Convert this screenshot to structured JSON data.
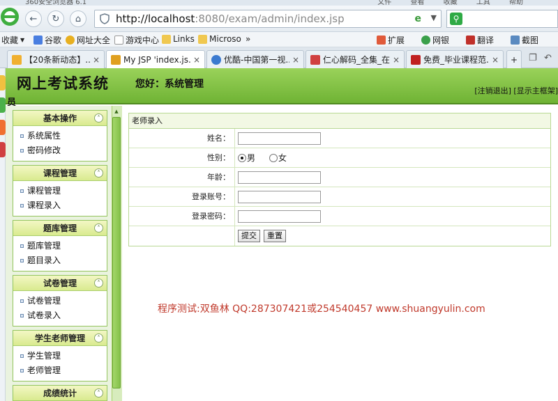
{
  "browser": {
    "title": "360安全浏览器 6.1",
    "menus": [
      "文件",
      "查看",
      "收藏",
      "工具",
      "帮助"
    ],
    "url_host": "http://localhost",
    "url_path": ":8080/exam/admin/index.jsp",
    "favorites_label": "收藏",
    "favorites": [
      "谷歌",
      "网址大全",
      "游戏中心",
      "Links",
      "Microso"
    ],
    "more": "»",
    "extensions": [
      "扩展",
      "网银",
      "翻译",
      "截图"
    ],
    "tabs": [
      {
        "label": "【20条新动态】..."
      },
      {
        "label": "My JSP 'index.js..."
      },
      {
        "label": "优酷-中国第一视..."
      },
      {
        "label": "仁心解码_全集_在..."
      },
      {
        "label": "免费_毕业课程范..."
      }
    ],
    "new_tab": "+"
  },
  "header": {
    "site_title": "网上考试系统",
    "greeting": "您好：系统管理",
    "greeting_overflow": "员",
    "logout": "[注销退出]",
    "show_frame": "[显示主框架]"
  },
  "sidebar": {
    "groups": [
      {
        "title": "基本操作",
        "items": [
          "系统属性",
          "密码修改"
        ]
      },
      {
        "title": "课程管理",
        "items": [
          "课程管理",
          "课程录入"
        ]
      },
      {
        "title": "题库管理",
        "items": [
          "题库管理",
          "题目录入"
        ]
      },
      {
        "title": "试卷管理",
        "items": [
          "试卷管理",
          "试卷录入"
        ]
      },
      {
        "title": "学生老师管理",
        "items": [
          "学生管理",
          "老师管理"
        ]
      },
      {
        "title": "成绩统计",
        "items": []
      }
    ]
  },
  "form": {
    "title": "老师录入",
    "name_label": "姓名：",
    "gender_label": "性别：",
    "gender_male": "男",
    "gender_female": "女",
    "age_label": "年龄：",
    "account_label": "登录账号：",
    "password_label": "登录密码：",
    "submit": "提交",
    "reset": "重置"
  },
  "watermark": "程序测试:双鱼林 QQ:287307421或254540457 www.shuangyulin.com",
  "colors": {
    "header_green": "#7fbf3f",
    "sidebar_bg": "#eaf3df",
    "watermark_red": "#c0392b"
  }
}
